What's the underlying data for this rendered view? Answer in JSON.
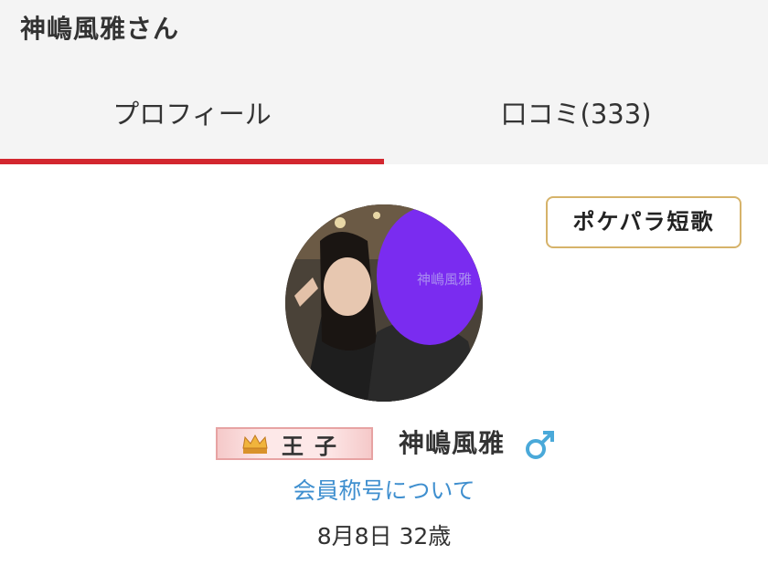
{
  "header": {
    "title": "神嶋風雅さん"
  },
  "tabs": [
    {
      "label": "プロフィール",
      "active": true
    },
    {
      "label": "口コミ(333)",
      "active": false
    }
  ],
  "tanka_button": {
    "label": "ポケパラ短歌"
  },
  "avatar": {
    "overlay_text": "神嶋風雅",
    "overlay_color": "#7a2cf0"
  },
  "profile": {
    "rank_badge": {
      "icon": "crown-icon",
      "label": "王子"
    },
    "name": "神嶋風雅",
    "gender_icon": "male-symbol-icon",
    "title_link": "会員称号について",
    "birthday_age": "8月8日 32歳"
  },
  "colors": {
    "accent": "#d3272f",
    "link": "#3f8fcf",
    "gender": "#4aa9d9",
    "tanka_border": "#d6b36a"
  }
}
